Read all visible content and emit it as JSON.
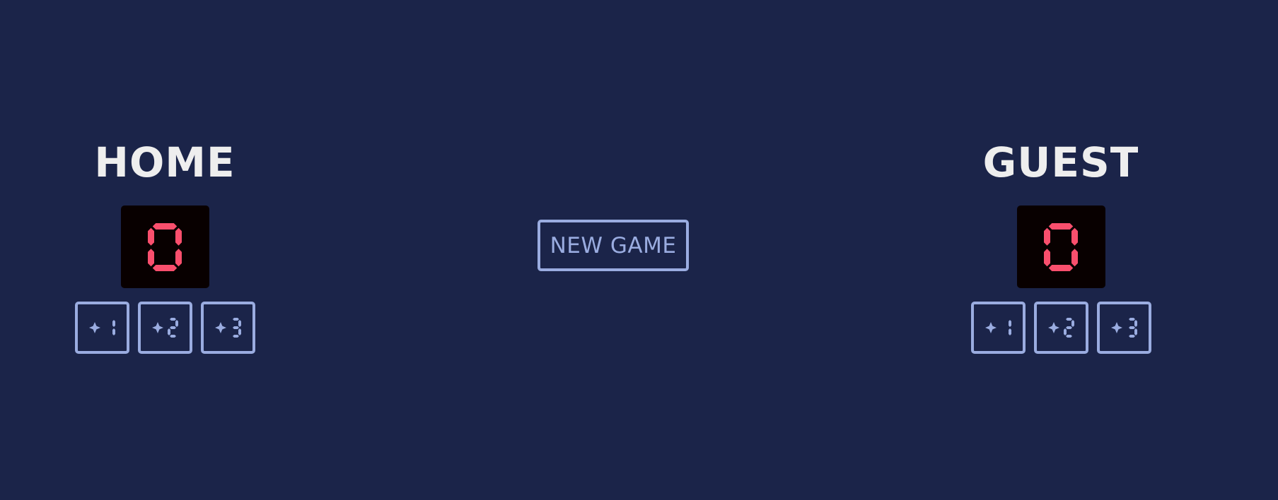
{
  "home": {
    "name": "HOME",
    "score": "0",
    "buttons": [
      "+1",
      "+2",
      "+3"
    ]
  },
  "guest": {
    "name": "GUEST",
    "score": "0",
    "buttons": [
      "+1",
      "+2",
      "+3"
    ]
  },
  "new_game_label": "NEW GAME",
  "colors": {
    "background": "#1b2449",
    "score_digit": "#f94f6d",
    "score_panel": "#080000",
    "button": "#9aace0",
    "team_name": "#eeeeee"
  }
}
